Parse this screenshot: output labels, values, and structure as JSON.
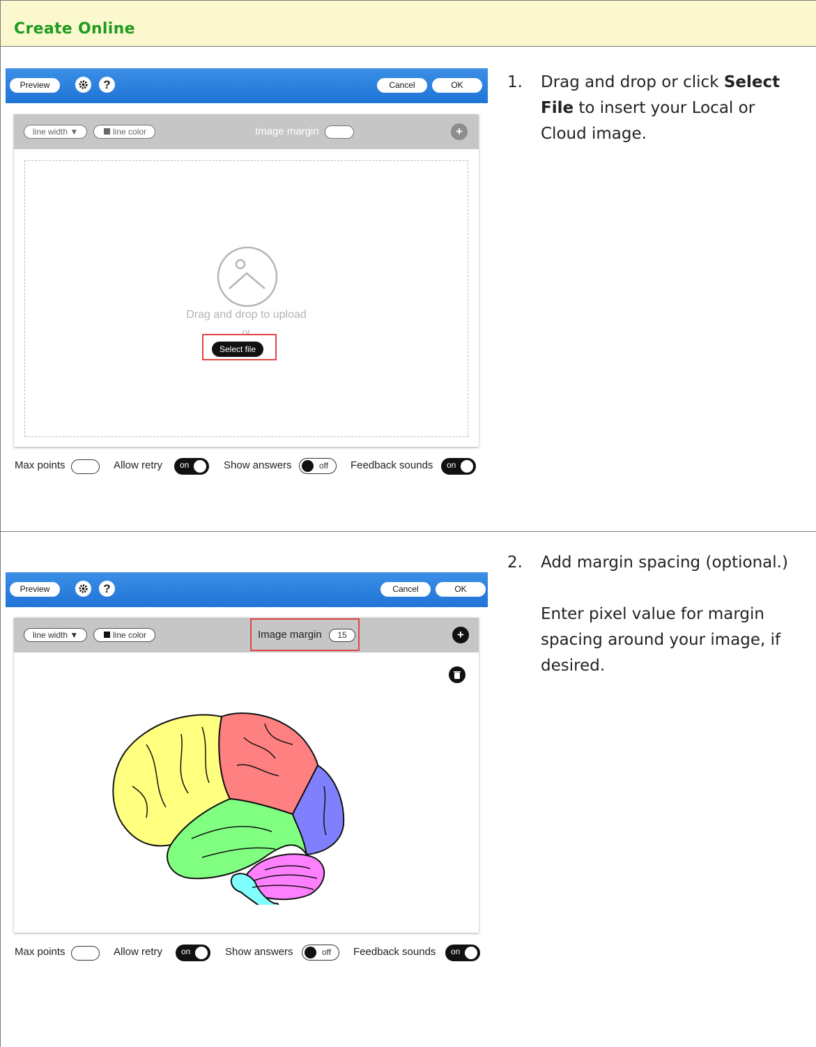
{
  "header": {
    "title": "Create Online"
  },
  "steps": [
    {
      "number": "1.",
      "text_before": "Drag and drop or click ",
      "bold": "Select File",
      "text_after": " to insert your Local or Cloud image."
    },
    {
      "number": "2.",
      "line1": "Add margin spacing (optional.)",
      "line2": "Enter pixel value for margin spacing around your image, if desired."
    }
  ],
  "editor": {
    "preview_label": "Preview",
    "cancel_label": "Cancel",
    "ok_label": "OK",
    "help_glyph": "?",
    "line_width_label": "line width ▼",
    "line_color_label": "line color",
    "image_margin_label": "Image margin",
    "add_glyph": "+",
    "drop_text": "Drag and drop to upload",
    "or_text": "or",
    "select_file_label": "Select file",
    "max_points_label": "Max points",
    "allow_retry_label": "Allow retry",
    "show_answers_label": "Show answers",
    "feedback_sounds_label": "Feedback sounds",
    "on_label": "on",
    "off_label": "off"
  },
  "editor2": {
    "image_margin_value": "15"
  },
  "colors": {
    "header_bg": "#fbf8cf",
    "title_green": "#1f9b1f",
    "topbar_blue": "#2a80de",
    "highlight_red": "#e04545",
    "brain_frontal": "#ffff80",
    "brain_parietal": "#ff8080",
    "brain_occipital": "#8080ff",
    "brain_temporal": "#80ff80",
    "brain_cerebellum": "#ff80ff",
    "brain_stem": "#80ffff"
  },
  "icons": [
    "gear-icon",
    "help-icon",
    "image-placeholder-icon",
    "plus-icon",
    "trash-icon"
  ]
}
